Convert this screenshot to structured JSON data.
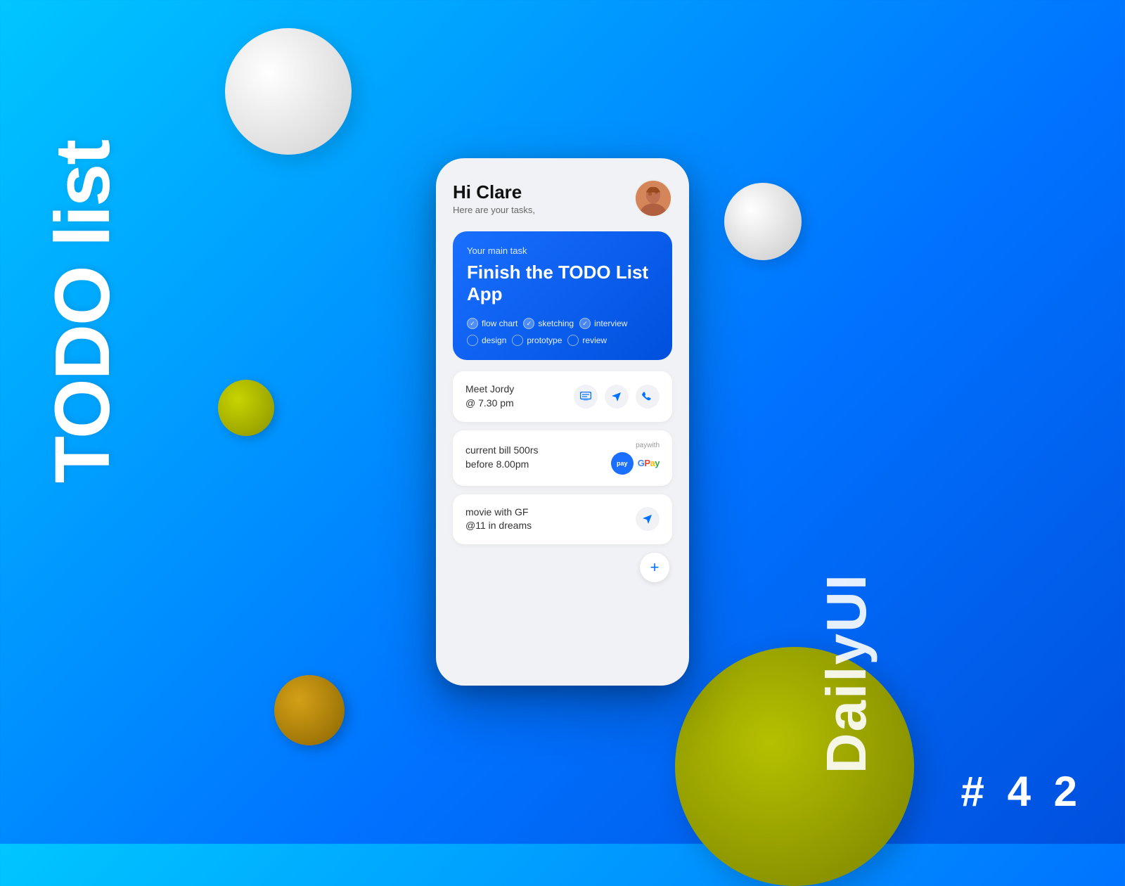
{
  "background": {
    "gradient_start": "#00c6ff",
    "gradient_end": "#0050dd"
  },
  "title_vertical": "TODO list",
  "branding": {
    "name": "DailyUI",
    "number": "# 4 2"
  },
  "phone": {
    "header": {
      "greeting": "Hi Clare",
      "subtitle": "Here are your tasks,"
    },
    "main_task": {
      "label": "Your main task",
      "title": "Finish the TODO List App",
      "tags": [
        {
          "name": "flow chart",
          "done": true
        },
        {
          "name": "sketching",
          "done": true
        },
        {
          "name": "interview",
          "done": true
        },
        {
          "name": "design",
          "done": false
        },
        {
          "name": "prototype",
          "done": false
        },
        {
          "name": "review",
          "done": false
        }
      ]
    },
    "tasks": [
      {
        "id": 1,
        "text": "Meet Jordy\n@ 7.30 pm",
        "actions": [
          "message",
          "navigate",
          "phone"
        ]
      },
      {
        "id": 2,
        "text": "current bill 500rs\nbefore 8.00pm",
        "actions": [
          "gpay"
        ]
      },
      {
        "id": 3,
        "text": "movie with GF\n@11 in dreams",
        "actions": [
          "navigate"
        ]
      }
    ],
    "add_button_label": "+"
  }
}
